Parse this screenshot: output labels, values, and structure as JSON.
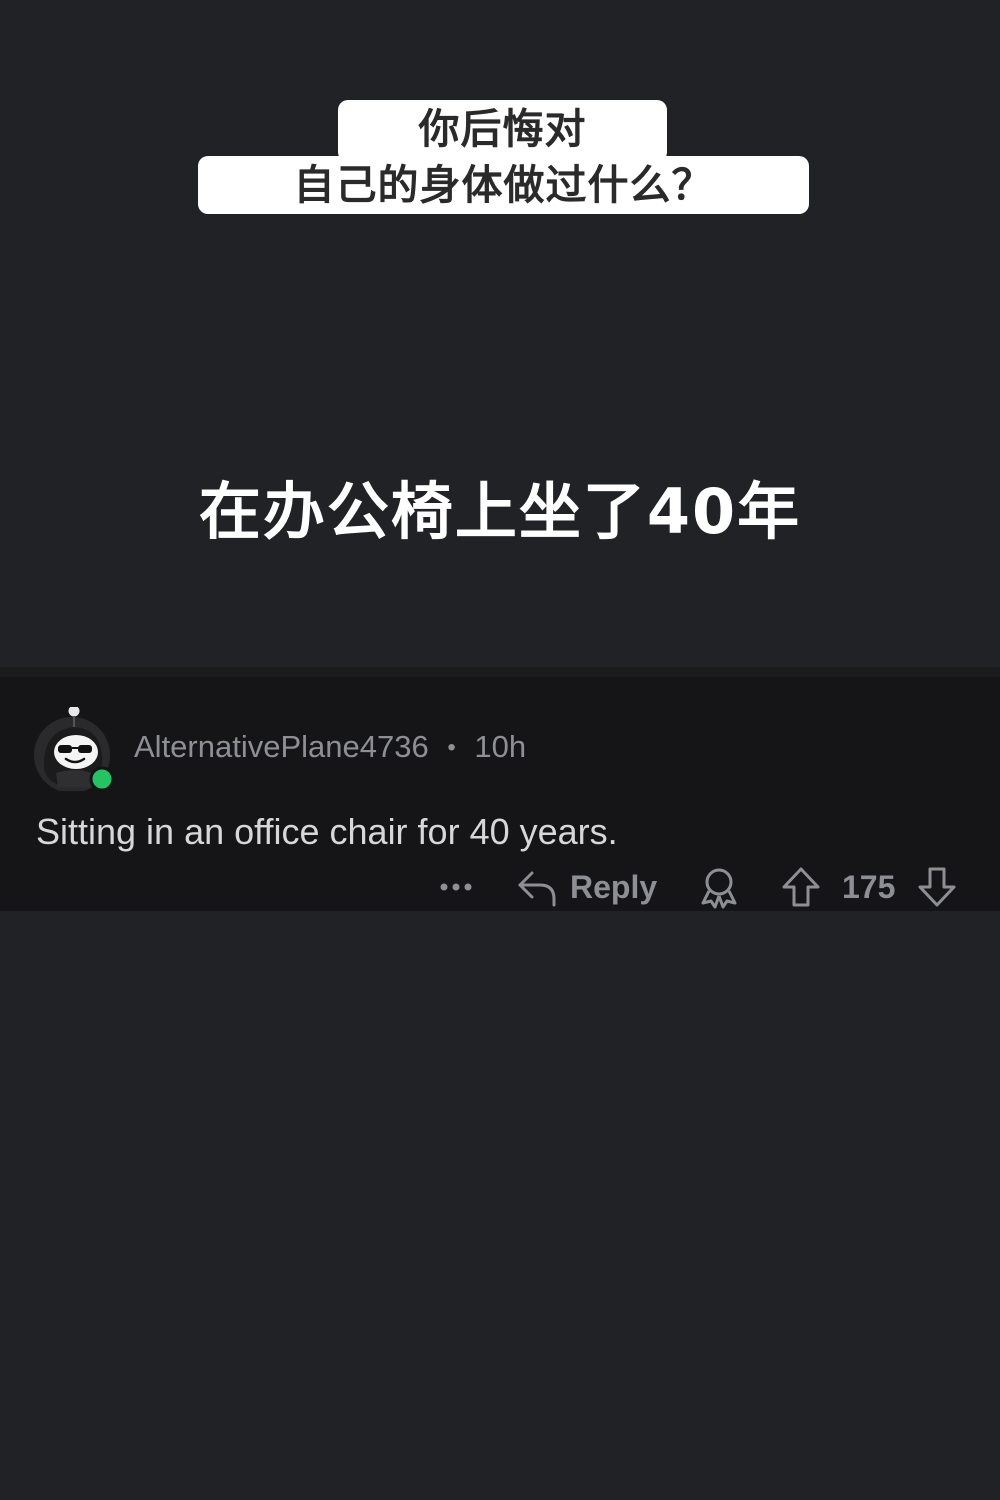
{
  "question": {
    "line1": "你后悔对",
    "line2": "自己的身体做过什么？"
  },
  "caption": "在办公椅上坐了40年",
  "comment": {
    "username": "AlternativePlane4736",
    "separator": "•",
    "time": "10h",
    "text": "Sitting in an office chair for 40 years.",
    "online": true,
    "actions": {
      "more_icon": "more-dots-icon",
      "reply_label": "Reply",
      "award_icon": "award-icon",
      "score": "175"
    }
  },
  "colors": {
    "background": "#212226",
    "card": "#151517",
    "muted_text": "#8e8f94",
    "online_dot": "#24c463"
  }
}
